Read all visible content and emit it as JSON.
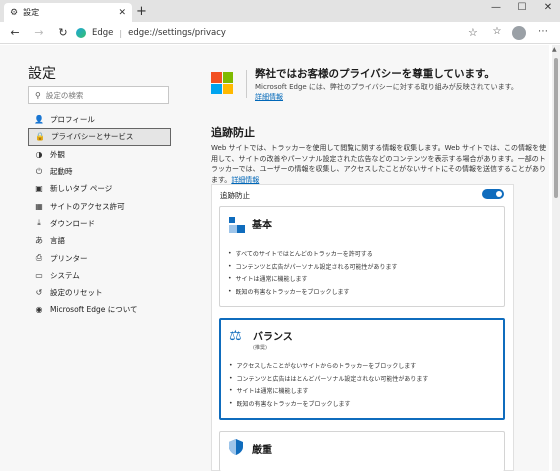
{
  "tab": {
    "title": "設定",
    "new_tab_symbol": "+"
  },
  "window_controls": {
    "minimize": "—",
    "maximize": "☐",
    "close": "✕"
  },
  "toolbar": {
    "site_label": "Edge",
    "url": "edge://settings/privacy"
  },
  "sidebar": {
    "title": "設定",
    "search_placeholder": "設定の検索",
    "items": [
      {
        "label": "プロフィール",
        "icon": "person-icon",
        "glyph": "👤"
      },
      {
        "label": "プライバシーとサービス",
        "icon": "lock-icon",
        "glyph": "🔒",
        "active": true
      },
      {
        "label": "外観",
        "icon": "appearance-icon",
        "glyph": "◑"
      },
      {
        "label": "起動時",
        "icon": "power-icon",
        "glyph": "⏻"
      },
      {
        "label": "新しいタブ ページ",
        "icon": "new-tab-icon",
        "glyph": "▣"
      },
      {
        "label": "サイトのアクセス許可",
        "icon": "permissions-icon",
        "glyph": "▦"
      },
      {
        "label": "ダウンロード",
        "icon": "download-icon",
        "glyph": "⤓"
      },
      {
        "label": "言語",
        "icon": "language-icon",
        "glyph": "あ"
      },
      {
        "label": "プリンター",
        "icon": "printer-icon",
        "glyph": "⎙"
      },
      {
        "label": "システム",
        "icon": "system-icon",
        "glyph": "▭"
      },
      {
        "label": "設定のリセット",
        "icon": "reset-icon",
        "glyph": "↺"
      },
      {
        "label": "Microsoft Edge について",
        "icon": "edge-icon",
        "glyph": "◉"
      }
    ]
  },
  "privacy_banner": {
    "headline": "弊社ではお客様のプライバシーを尊重しています。",
    "body": "Microsoft Edge には、弊社のプライバシーに対する取り組みが反映されています。",
    "link": "詳細情報"
  },
  "tracking": {
    "section_title": "追跡防止",
    "description": "Web サイトでは、トラッカーを使用して閲覧に関する情報を収集します。Web サイトでは、この情報を使用して、サイトの改善やパーソナル設定された広告などのコンテンツを表示する場合があります。一部のトラッカーでは、ユーザーの情報を収集し、アクセスしたことがないサイトにその情報を送信することがあります。",
    "description_link": "詳細情報",
    "toggle_label": "追跡防止",
    "toggle_on": true,
    "options": [
      {
        "title": "基本",
        "subtitle": "",
        "selected": false,
        "bullets": [
          "すべてのサイトではとんどのトラッカーを許可する",
          "コンテンツと広告がパーソナル設定される可能性があります",
          "サイトは通常に機能します",
          "既知の有害なトラッカーをブロックします"
        ]
      },
      {
        "title": "バランス",
        "subtitle": "(推奨)",
        "selected": true,
        "bullets": [
          "アクセスしたことがないサイトからのトラッカーをブロックします",
          "コンテンツと広告ははとんどパーソナル設定されない可能性があります",
          "サイトは通常に機能します",
          "既知の有害なトラッカーをブロックします"
        ]
      },
      {
        "title": "厳重",
        "subtitle": "",
        "selected": false,
        "bullets": []
      }
    ]
  },
  "colors": {
    "accent": "#0f6cbd",
    "ms_red": "#f25022",
    "ms_green": "#7fba00",
    "ms_blue": "#00a4ef",
    "ms_yellow": "#ffb900"
  }
}
